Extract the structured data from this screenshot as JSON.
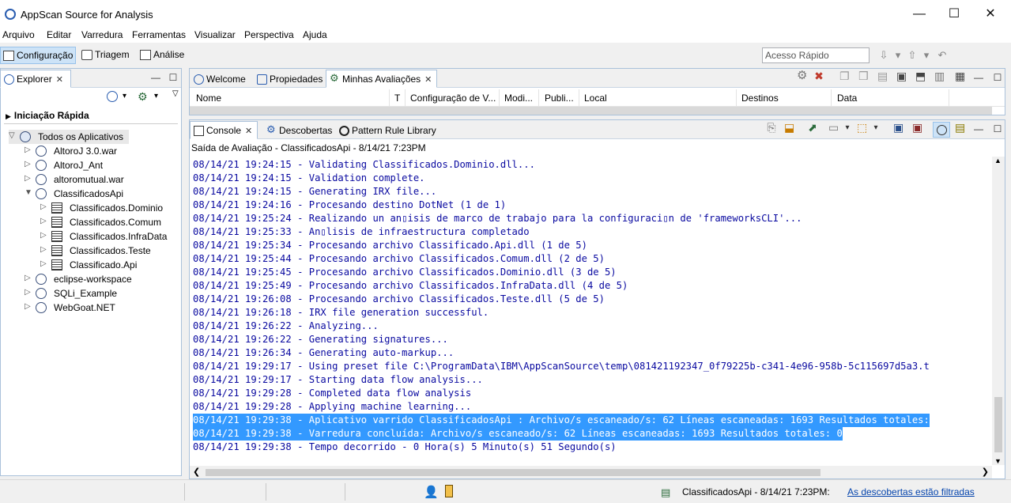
{
  "window": {
    "title": "AppScan Source for Analysis",
    "minimize": "—",
    "maximize": "☐",
    "close": "✕"
  },
  "menu": [
    "Arquivo",
    "Editar",
    "Varredura",
    "Ferramentas",
    "Visualizar",
    "Perspectiva",
    "Ajuda"
  ],
  "perspectives": [
    "Configuração",
    "Triagem",
    "Análise"
  ],
  "quick_access": {
    "placeholder": "Acesso Rápido"
  },
  "explorer": {
    "tab": "Explorer",
    "quick_start": "Iniciação Rápida",
    "root": "Todos os Aplicativos",
    "apps_before": [
      "AltoroJ 3.0.war",
      "AltoroJ_Ant",
      "altoromutual.war"
    ],
    "expanded_app": "ClassificadosApi",
    "projects": [
      "Classificados.Dominio",
      "Classificados.Comum",
      "Classificados.InfraData",
      "Classificados.Teste",
      "Classificado.Api"
    ],
    "apps_after": [
      "eclipse-workspace",
      "SQLi_Example",
      "WebGoat.NET"
    ]
  },
  "top_tabs": [
    "Welcome",
    "Propiedades",
    "Minhas Avaliações"
  ],
  "assessment_table": {
    "columns": [
      "Nome",
      "T",
      "Configuração de V...",
      "Modi...",
      "Publi...",
      "Local",
      "Destinos",
      "Data"
    ]
  },
  "bottom_tabs": [
    "Console",
    "Descobertas",
    "Pattern Rule Library"
  ],
  "console": {
    "subtitle": "Saída de Avaliação - ClassificadosApi - 8/14/21 7:23PM",
    "lines": [
      "08/14/21 19:24:15 - Validating Classificados.Dominio.dll...",
      "08/14/21 19:24:15 - Validation complete.",
      "08/14/21 19:24:15 - Generating IRX file...",
      "08/14/21 19:24:16 - Procesando destino DotNet (1 de 1)",
      "08/14/21 19:25:24 - Realizando un an▯isis de marco de trabajo para la configuraci▯n de 'frameworksCLI'...",
      "08/14/21 19:25:33 - An▯lisis de infraestructura completado",
      "08/14/21 19:25:34 - Procesando archivo Classificado.Api.dll (1 de 5)",
      "08/14/21 19:25:44 - Procesando archivo Classificados.Comum.dll (2 de 5)",
      "08/14/21 19:25:45 - Procesando archivo Classificados.Dominio.dll (3 de 5)",
      "08/14/21 19:25:49 - Procesando archivo Classificados.InfraData.dll (4 de 5)",
      "08/14/21 19:26:08 - Procesando archivo Classificados.Teste.dll (5 de 5)",
      "08/14/21 19:26:18 - IRX file generation successful.",
      "08/14/21 19:26:22 - Analyzing...",
      "08/14/21 19:26:22 - Generating signatures...",
      "08/14/21 19:26:34 - Generating auto-markup...",
      "08/14/21 19:29:17 - Using preset file C:\\ProgramData\\IBM\\AppScanSource\\temp\\081421192347_0f79225b-c341-4e96-958b-5c115697d5a3.t",
      "08/14/21 19:29:17 - Starting data flow analysis...",
      "08/14/21 19:29:28 - Completed data flow analysis",
      "08/14/21 19:29:28 - Applying machine learning...",
      "08/14/21 19:29:38 - Aplicativo varrido ClassificadosApi : Archivo/s escaneado/s: 62 Líneas escaneadas: 1693 Resultados totales:",
      "08/14/21 19:29:38 - Varredura concluída: Archivo/s escaneado/s: 62 Líneas escaneadas: 1693 Resultados totales: 0",
      "08/14/21 19:29:38 - Tempo decorrido - 0 Hora(s) 5 Minuto(s) 51 Segundo(s)"
    ],
    "highlighted": [
      19,
      20
    ]
  },
  "status": {
    "scan_info": "ClassificadosApi - 8/14/21 7:23PM:",
    "filter_link": "As descobertas estão filtradas"
  },
  "colors": {
    "selection": "#3399ff",
    "console_text": "#0a0aa0",
    "link": "#0645ad"
  }
}
